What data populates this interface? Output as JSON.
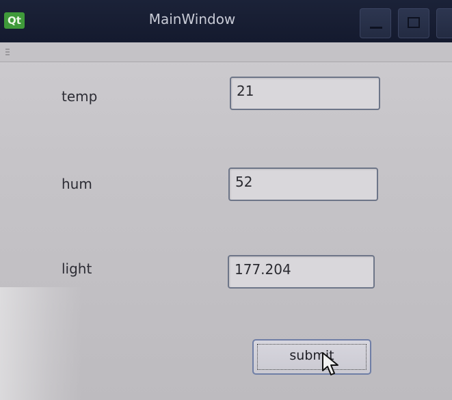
{
  "window": {
    "title": "MainWindow",
    "logo_text": "Qt",
    "titlebar_color": "#1b2238"
  },
  "form": {
    "fields": [
      {
        "label": "temp",
        "value": "21"
      },
      {
        "label": "hum",
        "value": "52"
      },
      {
        "label": "light",
        "value": "177.204"
      }
    ],
    "submit_label": "submit"
  },
  "icons": [
    "qt-logo-icon",
    "minimize-icon",
    "maximize-icon",
    "close-icon",
    "mouse-pointer-icon"
  ]
}
